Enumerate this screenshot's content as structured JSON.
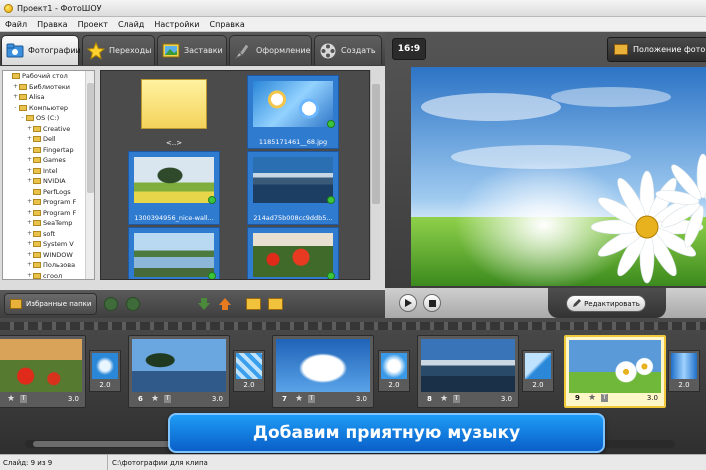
{
  "window": {
    "title": "Проект1 - ФотоШОУ"
  },
  "menu": [
    "Файл",
    "Правка",
    "Проект",
    "Слайд",
    "Настройки",
    "Справка"
  ],
  "tabs": [
    {
      "label": "Фотографии",
      "icon": "photos-folder-icon",
      "active": true
    },
    {
      "label": "Переходы",
      "icon": "star-icon",
      "active": false
    },
    {
      "label": "Заставки",
      "icon": "picture-icon",
      "active": false
    },
    {
      "label": "Оформление",
      "icon": "brush-icon",
      "active": false
    },
    {
      "label": "Создать",
      "icon": "film-reel-icon",
      "active": false
    }
  ],
  "tree": [
    {
      "label": "Рабочий стол",
      "depth": 0,
      "exp": ""
    },
    {
      "label": "Библиотеки",
      "depth": 1,
      "exp": "+"
    },
    {
      "label": "Alisa",
      "depth": 1,
      "exp": "+"
    },
    {
      "label": "Компьютер",
      "depth": 1,
      "exp": "-"
    },
    {
      "label": "OS (C:)",
      "depth": 2,
      "exp": "-"
    },
    {
      "label": "Creative",
      "depth": 3,
      "exp": "+"
    },
    {
      "label": "Dell",
      "depth": 3,
      "exp": "+"
    },
    {
      "label": "Fingertap",
      "depth": 3,
      "exp": "+"
    },
    {
      "label": "Games",
      "depth": 3,
      "exp": "+"
    },
    {
      "label": "Intel",
      "depth": 3,
      "exp": "+"
    },
    {
      "label": "NVIDIA",
      "depth": 3,
      "exp": "+"
    },
    {
      "label": "PerfLogs",
      "depth": 3,
      "exp": ""
    },
    {
      "label": "Program F",
      "depth": 3,
      "exp": "+"
    },
    {
      "label": "Program F",
      "depth": 3,
      "exp": "+"
    },
    {
      "label": "SeaTemp",
      "depth": 3,
      "exp": "+"
    },
    {
      "label": "soft",
      "depth": 3,
      "exp": "+"
    },
    {
      "label": "System V",
      "depth": 3,
      "exp": "+"
    },
    {
      "label": "WINDOW",
      "depth": 3,
      "exp": "+"
    },
    {
      "label": "Пользова",
      "depth": 3,
      "exp": "+"
    },
    {
      "label": "сгоол",
      "depth": 3,
      "exp": "+"
    }
  ],
  "photos": [
    {
      "caption": "<..>",
      "kind": "folder"
    },
    {
      "caption": "1185171461__68.jpg",
      "kind": "flowers"
    },
    {
      "caption": "1300394956_nice-wall...",
      "kind": "tree"
    },
    {
      "caption": "214ad75b008cc9ddb5...",
      "kind": "lake"
    },
    {
      "caption": "",
      "kind": "river"
    },
    {
      "caption": "",
      "kind": "poppies"
    }
  ],
  "favorites_label": "Избранные папки",
  "preview": {
    "ratio": "16:9",
    "position_label": "Положение фото",
    "edit_label": "Редактировать"
  },
  "timeline": {
    "slides": [
      {
        "num": "",
        "dur": "3.0",
        "kind": "poppies"
      },
      {
        "num": "6",
        "dur": "3.0",
        "kind": "tree"
      },
      {
        "num": "7",
        "dur": "3.0",
        "kind": "clouds"
      },
      {
        "num": "8",
        "dur": "3.0",
        "kind": "lake"
      },
      {
        "num": "9",
        "dur": "3.0",
        "kind": "daisy",
        "selected": true
      }
    ],
    "transitions": [
      {
        "dur": "2.0"
      },
      {
        "dur": "2.0"
      },
      {
        "dur": "2.0"
      },
      {
        "dur": "2.0"
      },
      {
        "dur": "2.0"
      }
    ]
  },
  "banner": "Добавим приятную музыку",
  "status": {
    "slide": "Слайд: 9 из 9",
    "path": "C:\\фотографии для клипа"
  }
}
